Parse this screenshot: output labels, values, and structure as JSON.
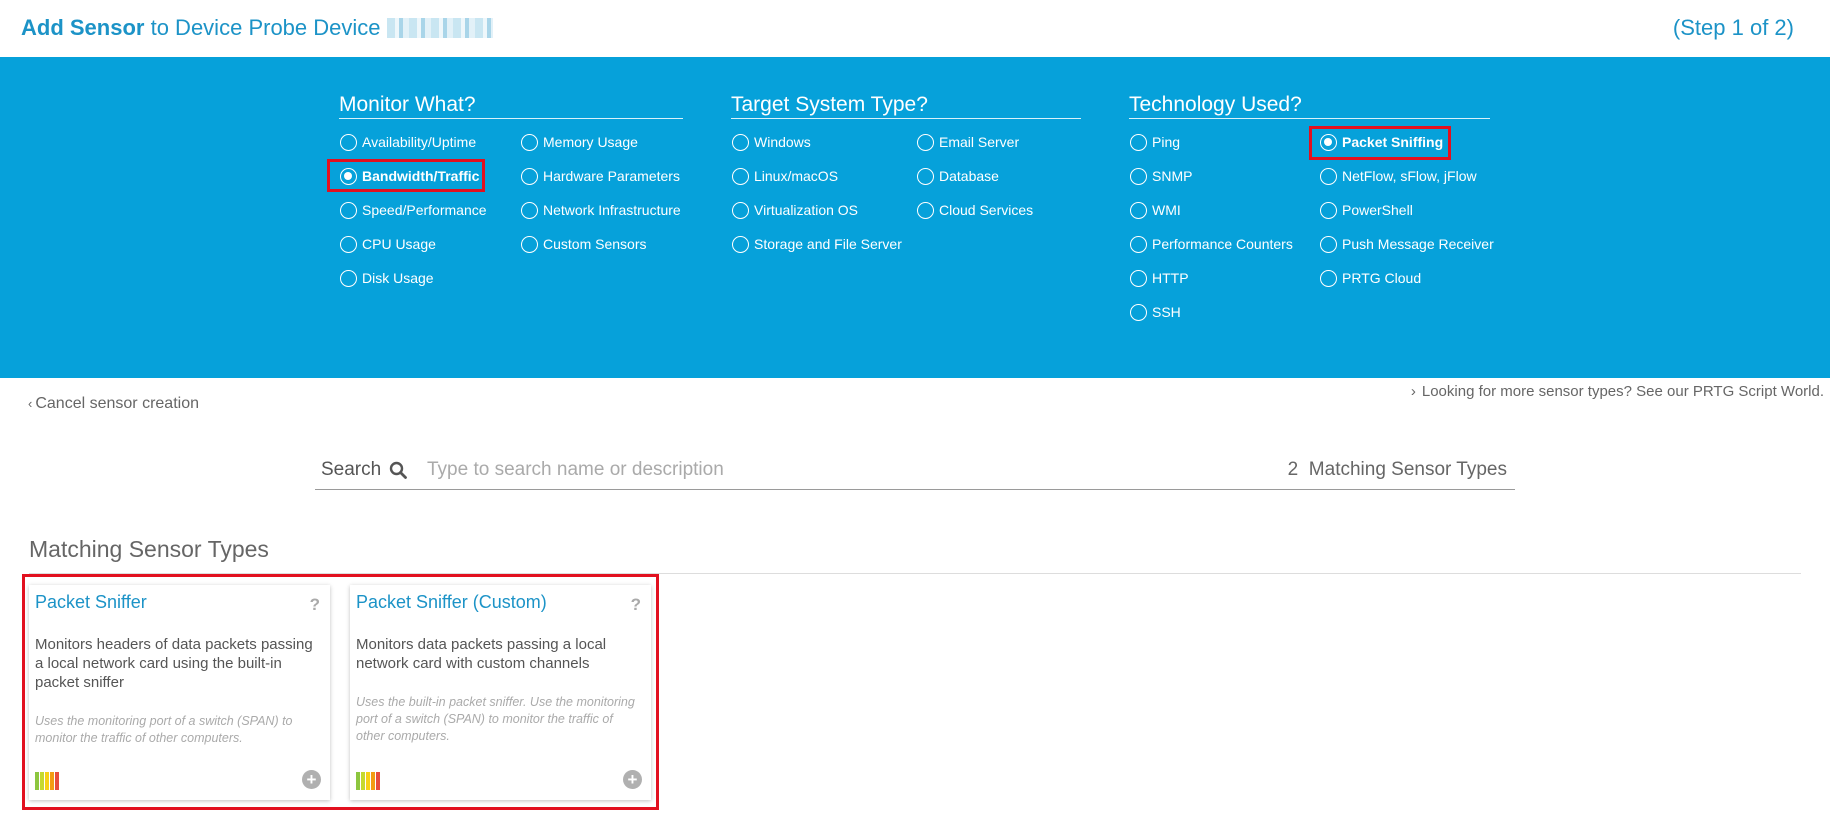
{
  "header": {
    "title_strong": "Add Sensor",
    "title_rest": "to Device",
    "device_name": "Probe Device",
    "step": "(Step 1 of 2)"
  },
  "filters": {
    "monitor_what": {
      "title": "Monitor What?",
      "options": [
        "Availability/Uptime",
        "Bandwidth/Traffic",
        "Speed/Performance",
        "CPU Usage",
        "Disk Usage",
        "Memory Usage",
        "Hardware Parameters",
        "Network Infrastructure",
        "Custom Sensors"
      ],
      "selected": "Bandwidth/Traffic"
    },
    "target_system": {
      "title": "Target System Type?",
      "options": [
        "Windows",
        "Linux/macOS",
        "Virtualization OS",
        "Storage and File Server",
        "Email Server",
        "Database",
        "Cloud Services"
      ]
    },
    "technology": {
      "title": "Technology Used?",
      "options": [
        "Ping",
        "SNMP",
        "WMI",
        "Performance Counters",
        "HTTP",
        "SSH",
        "Packet Sniffing",
        "NetFlow, sFlow, jFlow",
        "PowerShell",
        "Push Message Receiver",
        "PRTG Cloud"
      ],
      "selected": "Packet Sniffing"
    }
  },
  "links": {
    "cancel": "Cancel sensor creation",
    "more": "Looking for more sensor types? See our PRTG Script World."
  },
  "search": {
    "label": "Search",
    "placeholder": "Type to search name or description",
    "match_count": "2",
    "match_label": "Matching Sensor Types"
  },
  "results": {
    "title": "Matching Sensor Types",
    "cards": [
      {
        "name": "Packet Sniffer",
        "description": "Monitors headers of data packets passing a local network card using the built-in packet sniffer",
        "note": "Uses the monitoring port of a switch (SPAN) to monitor the traffic of other computers."
      },
      {
        "name": "Packet Sniffer (Custom)",
        "description": "Monitors data packets passing a local network card with custom channels",
        "note": "Uses the built-in packet sniffer. Use the monitoring port of a switch (SPAN) to monitor the traffic of other computers."
      }
    ],
    "help_glyph": "?",
    "add_glyph": "+"
  },
  "icons": {
    "performance_bars": [
      "#8dc63f",
      "#c6d92f",
      "#f7d117",
      "#f39c12",
      "#e74c3c"
    ],
    "help": "help-icon",
    "add": "add-icon",
    "search": "search-icon"
  },
  "colors": {
    "accent": "#1c93c7",
    "banner": "#06a1da",
    "highlight": "#e2101f"
  }
}
